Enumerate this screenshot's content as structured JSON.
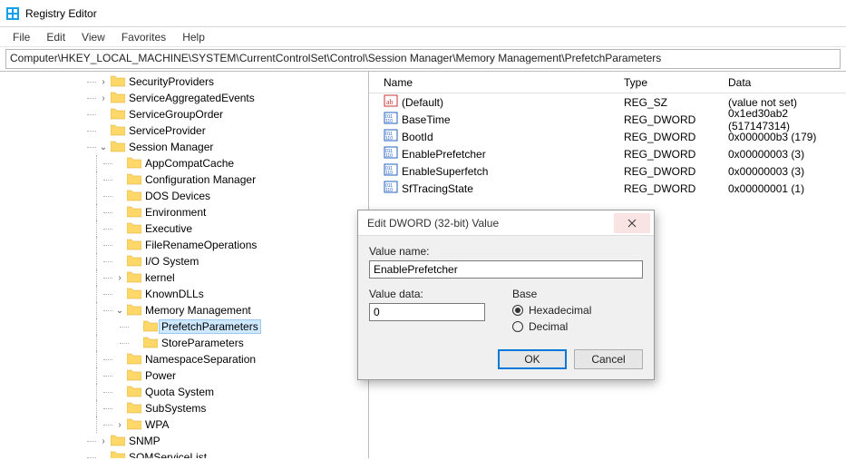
{
  "window": {
    "title": "Registry Editor"
  },
  "menu": {
    "file": "File",
    "edit": "Edit",
    "view": "View",
    "favorites": "Favorites",
    "help": "Help"
  },
  "address": "Computer\\HKEY_LOCAL_MACHINE\\SYSTEM\\CurrentControlSet\\Control\\Session Manager\\Memory Management\\PrefetchParameters",
  "list": {
    "headers": {
      "name": "Name",
      "type": "Type",
      "data": "Data"
    },
    "rows": [
      {
        "icon": "sz",
        "name": "(Default)",
        "type": "REG_SZ",
        "data": "(value not set)"
      },
      {
        "icon": "dw",
        "name": "BaseTime",
        "type": "REG_DWORD",
        "data": "0x1ed30ab2 (517147314)"
      },
      {
        "icon": "dw",
        "name": "BootId",
        "type": "REG_DWORD",
        "data": "0x000000b3 (179)"
      },
      {
        "icon": "dw",
        "name": "EnablePrefetcher",
        "type": "REG_DWORD",
        "data": "0x00000003 (3)"
      },
      {
        "icon": "dw",
        "name": "EnableSuperfetch",
        "type": "REG_DWORD",
        "data": "0x00000003 (3)"
      },
      {
        "icon": "dw",
        "name": "SfTracingState",
        "type": "REG_DWORD",
        "data": "0x00000001 (1)"
      }
    ]
  },
  "tree": {
    "l0": [
      {
        "exp": ">",
        "label": "SecurityProviders"
      },
      {
        "exp": ">",
        "label": "ServiceAggregatedEvents"
      },
      {
        "exp": "",
        "label": "ServiceGroupOrder"
      },
      {
        "exp": "",
        "label": "ServiceProvider"
      }
    ],
    "session": {
      "exp": "v",
      "label": "Session Manager"
    },
    "session_children": [
      {
        "exp": "",
        "label": "AppCompatCache"
      },
      {
        "exp": "",
        "label": "Configuration Manager"
      },
      {
        "exp": "",
        "label": "DOS Devices"
      },
      {
        "exp": "",
        "label": "Environment"
      },
      {
        "exp": "",
        "label": "Executive"
      },
      {
        "exp": "",
        "label": "FileRenameOperations"
      },
      {
        "exp": "",
        "label": "I/O System"
      },
      {
        "exp": ">",
        "label": "kernel"
      },
      {
        "exp": "",
        "label": "KnownDLLs"
      }
    ],
    "memory": {
      "exp": "v",
      "label": "Memory Management"
    },
    "memory_children": [
      {
        "label": "PrefetchParameters",
        "selected": true
      },
      {
        "label": "StoreParameters"
      }
    ],
    "session_tail": [
      {
        "exp": "",
        "label": "NamespaceSeparation"
      },
      {
        "exp": "",
        "label": "Power"
      },
      {
        "exp": "",
        "label": "Quota System"
      },
      {
        "exp": "",
        "label": "SubSystems"
      },
      {
        "exp": ">",
        "label": "WPA"
      }
    ],
    "l0_tail": [
      {
        "exp": ">",
        "label": "SNMP"
      },
      {
        "exp": "",
        "label": "SQMServiceList"
      }
    ]
  },
  "dialog": {
    "title": "Edit DWORD (32-bit) Value",
    "value_name_label": "Value name:",
    "value_name": "EnablePrefetcher",
    "value_data_label": "Value data:",
    "value_data": "0",
    "base_label": "Base",
    "hex": "Hexadecimal",
    "dec": "Decimal",
    "ok": "OK",
    "cancel": "Cancel"
  }
}
